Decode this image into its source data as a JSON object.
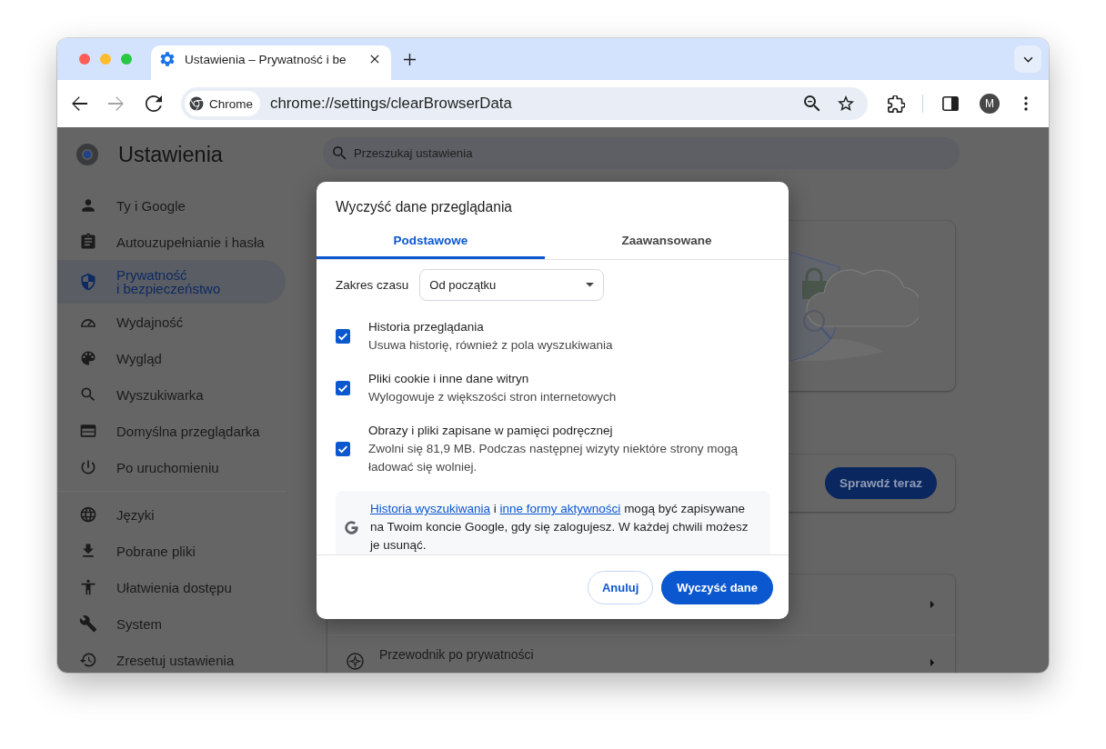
{
  "browser": {
    "tabs": [
      {
        "title": "Ustawienia – Prywatność i be",
        "selected": true
      }
    ],
    "nav": [
      {
        "kind": "back",
        "disabled": false
      },
      {
        "kind": "forward",
        "disabled": true
      },
      {
        "kind": "reload",
        "disabled": false
      }
    ],
    "omnibox": {
      "chip": "Chrome",
      "url": "chrome://settings/clearBrowserData"
    },
    "profile": {
      "initial": "M"
    }
  },
  "settings": {
    "title": "Ustawienia",
    "search": {
      "placeholder": "Przeszukaj ustawienia"
    },
    "sidebar": {
      "groups": [
        {
          "items": [
            {
              "kind": "person",
              "label": "Ty i Google",
              "selected": false
            },
            {
              "kind": "autofill",
              "label": "Autouzupełnianie i hasła",
              "selected": false
            },
            {
              "kind": "privacy",
              "label": "Prywatność i bezpieczeństwo",
              "selected": true
            },
            {
              "kind": "performance",
              "label": "Wydajność",
              "selected": false
            },
            {
              "kind": "appearance",
              "label": "Wygląd",
              "selected": false
            },
            {
              "kind": "search",
              "label": "Wyszukiwarka",
              "selected": false
            },
            {
              "kind": "browser",
              "label": "Domyślna przeglądarka",
              "selected": false
            },
            {
              "kind": "startup",
              "label": "Po uruchomieniu",
              "selected": false
            }
          ]
        },
        {
          "items": [
            {
              "kind": "languages",
              "label": "Języki",
              "selected": false
            },
            {
              "kind": "downloads",
              "label": "Pobrane pliki",
              "selected": false
            },
            {
              "kind": "accessibility",
              "label": "Ułatwienia dostępu",
              "selected": false
            },
            {
              "kind": "system",
              "label": "System",
              "selected": false
            },
            {
              "kind": "reset",
              "label": "Zresetuj ustawienia",
              "selected": false
            }
          ]
        }
      ]
    },
    "cards": [
      {
        "kind": "illustration"
      },
      {
        "kind": "action",
        "button": "Sprawdź teraz"
      },
      {
        "kind": "list",
        "rows": [
          {
            "kind": "covered"
          },
          {
            "kind": "guide",
            "title": "Przewodnik po prywatności"
          }
        ]
      }
    ]
  },
  "dialog": {
    "title": "Wyczyść dane przeglądania",
    "tabs": [
      {
        "label": "Podstawowe",
        "selected": true
      },
      {
        "label": "Zaawansowane",
        "selected": false
      }
    ],
    "time_range": {
      "label": "Zakres czasu",
      "value": "Od początku"
    },
    "options": [
      {
        "title": "Historia przeglądania",
        "description": "Usuwa historię, również z pola wyszukiwania",
        "checked": true
      },
      {
        "title": "Pliki cookie i inne dane witryn",
        "description": "Wylogowuje z większości stron internetowych",
        "checked": true
      },
      {
        "title": "Obrazy i pliki zapisane w pamięci podręcznej",
        "description": "Zwolni się 81,9 MB. Podczas następnej wizyty niektóre strony mogą ładować się wolniej.",
        "checked": true
      }
    ],
    "info": {
      "parts": [
        {
          "kind": "link",
          "text": "Historia wyszukiwania"
        },
        {
          "kind": "text",
          "text": " i "
        },
        {
          "kind": "link",
          "text": "inne formy aktywności"
        },
        {
          "kind": "text",
          "text": " mogą być zapisywane na Twoim koncie Google, gdy się zalogujesz. W każdej chwili możesz je usunąć."
        }
      ]
    },
    "buttons": [
      {
        "kind": "outlined",
        "label": "Anuluj"
      },
      {
        "kind": "filled",
        "label": "Wyczyść dane"
      }
    ]
  }
}
